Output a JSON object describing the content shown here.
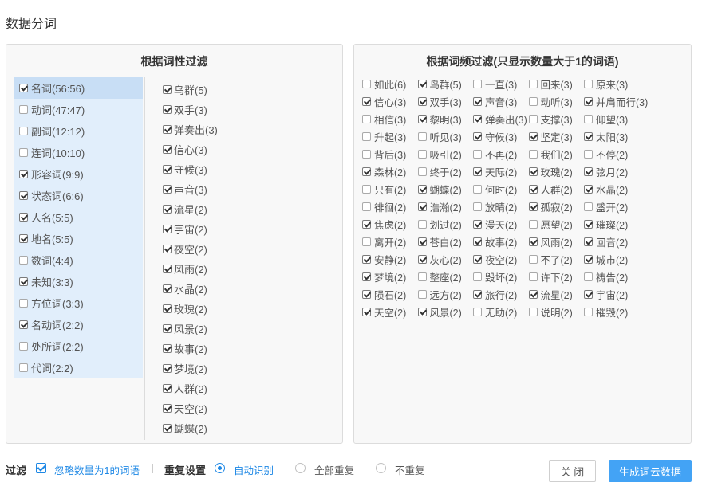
{
  "page": {
    "title": "数据分词"
  },
  "left_panel": {
    "title": "根据词性过滤",
    "pos_items": [
      {
        "label": "名词(56:56)",
        "checked": true,
        "active": true
      },
      {
        "label": "动词(47:47)",
        "checked": false
      },
      {
        "label": "副词(12:12)",
        "checked": false
      },
      {
        "label": "连词(10:10)",
        "checked": false
      },
      {
        "label": "形容词(9:9)",
        "checked": true
      },
      {
        "label": "状态词(6:6)",
        "checked": true
      },
      {
        "label": "人名(5:5)",
        "checked": true
      },
      {
        "label": "地名(5:5)",
        "checked": true
      },
      {
        "label": "数词(4:4)",
        "checked": false
      },
      {
        "label": "未知(3:3)",
        "checked": true
      },
      {
        "label": "方位词(3:3)",
        "checked": false
      },
      {
        "label": "名动词(2:2)",
        "checked": true
      },
      {
        "label": "处所词(2:2)",
        "checked": false
      },
      {
        "label": "代词(2:2)",
        "checked": false
      }
    ],
    "words": [
      {
        "label": "鸟群(5)",
        "checked": true
      },
      {
        "label": "双手(3)",
        "checked": true
      },
      {
        "label": "弹奏出(3)",
        "checked": true
      },
      {
        "label": "信心(3)",
        "checked": true
      },
      {
        "label": "守候(3)",
        "checked": true
      },
      {
        "label": "声音(3)",
        "checked": true
      },
      {
        "label": "流星(2)",
        "checked": true
      },
      {
        "label": "宇宙(2)",
        "checked": true
      },
      {
        "label": "夜空(2)",
        "checked": true
      },
      {
        "label": "风雨(2)",
        "checked": true
      },
      {
        "label": "水晶(2)",
        "checked": true
      },
      {
        "label": "玫瑰(2)",
        "checked": true
      },
      {
        "label": "风景(2)",
        "checked": true
      },
      {
        "label": "故事(2)",
        "checked": true
      },
      {
        "label": "梦境(2)",
        "checked": true
      },
      {
        "label": "人群(2)",
        "checked": true
      },
      {
        "label": "天空(2)",
        "checked": true
      },
      {
        "label": "蝴蝶(2)",
        "checked": true
      }
    ]
  },
  "right_panel": {
    "title": "根据词频过滤(只显示数量大于1的词语)",
    "rows": [
      [
        {
          "label": "如此(6)",
          "checked": false
        },
        {
          "label": "鸟群(5)",
          "checked": true
        },
        {
          "label": "一直(3)",
          "checked": false
        },
        {
          "label": "回来(3)",
          "checked": false
        },
        {
          "label": "原来(3)",
          "checked": false
        }
      ],
      [
        {
          "label": "信心(3)",
          "checked": true
        },
        {
          "label": "双手(3)",
          "checked": true
        },
        {
          "label": "声音(3)",
          "checked": true
        },
        {
          "label": "动听(3)",
          "checked": false
        },
        {
          "label": "并肩而行(3)",
          "checked": true
        }
      ],
      [
        {
          "label": "相信(3)",
          "checked": false
        },
        {
          "label": "黎明(3)",
          "checked": true
        },
        {
          "label": "弹奏出(3)",
          "checked": true
        },
        {
          "label": "支撑(3)",
          "checked": false
        },
        {
          "label": "仰望(3)",
          "checked": false
        }
      ],
      [
        {
          "label": "升起(3)",
          "checked": false
        },
        {
          "label": "听见(3)",
          "checked": false
        },
        {
          "label": "守候(3)",
          "checked": true
        },
        {
          "label": "坚定(3)",
          "checked": true
        },
        {
          "label": "太阳(3)",
          "checked": true
        }
      ],
      [
        {
          "label": "背后(3)",
          "checked": false
        },
        {
          "label": "吸引(2)",
          "checked": false
        },
        {
          "label": "不再(2)",
          "checked": false
        },
        {
          "label": "我们(2)",
          "checked": false
        },
        {
          "label": "不停(2)",
          "checked": false
        }
      ],
      [
        {
          "label": "森林(2)",
          "checked": true
        },
        {
          "label": "终于(2)",
          "checked": false
        },
        {
          "label": "天际(2)",
          "checked": true
        },
        {
          "label": "玫瑰(2)",
          "checked": true
        },
        {
          "label": "弦月(2)",
          "checked": true
        }
      ],
      [
        {
          "label": "只有(2)",
          "checked": false
        },
        {
          "label": "蝴蝶(2)",
          "checked": true
        },
        {
          "label": "何时(2)",
          "checked": false
        },
        {
          "label": "人群(2)",
          "checked": true
        },
        {
          "label": "水晶(2)",
          "checked": true
        }
      ],
      [
        {
          "label": "徘徊(2)",
          "checked": false
        },
        {
          "label": "浩瀚(2)",
          "checked": true
        },
        {
          "label": "放晴(2)",
          "checked": false
        },
        {
          "label": "孤寂(2)",
          "checked": true
        },
        {
          "label": "盛开(2)",
          "checked": false
        }
      ],
      [
        {
          "label": "焦虑(2)",
          "checked": true
        },
        {
          "label": "划过(2)",
          "checked": false
        },
        {
          "label": "漫天(2)",
          "checked": true
        },
        {
          "label": "愿望(2)",
          "checked": false
        },
        {
          "label": "璀璨(2)",
          "checked": true
        }
      ],
      [
        {
          "label": "离开(2)",
          "checked": false
        },
        {
          "label": "苍白(2)",
          "checked": true
        },
        {
          "label": "故事(2)",
          "checked": true
        },
        {
          "label": "风雨(2)",
          "checked": true
        },
        {
          "label": "回音(2)",
          "checked": true
        }
      ],
      [
        {
          "label": "安静(2)",
          "checked": true
        },
        {
          "label": "灰心(2)",
          "checked": true
        },
        {
          "label": "夜空(2)",
          "checked": true
        },
        {
          "label": "不了(2)",
          "checked": false
        },
        {
          "label": "城市(2)",
          "checked": true
        }
      ],
      [
        {
          "label": "梦境(2)",
          "checked": true
        },
        {
          "label": "整座(2)",
          "checked": false
        },
        {
          "label": "毁坏(2)",
          "checked": false
        },
        {
          "label": "许下(2)",
          "checked": false
        },
        {
          "label": "祷告(2)",
          "checked": false
        }
      ],
      [
        {
          "label": "陨石(2)",
          "checked": true
        },
        {
          "label": "远方(2)",
          "checked": false
        },
        {
          "label": "旅行(2)",
          "checked": true
        },
        {
          "label": "流星(2)",
          "checked": true
        },
        {
          "label": "宇宙(2)",
          "checked": true
        }
      ],
      [
        {
          "label": "天空(2)",
          "checked": true
        },
        {
          "label": "风景(2)",
          "checked": true
        },
        {
          "label": "无助(2)",
          "checked": false
        },
        {
          "label": "说明(2)",
          "checked": false
        },
        {
          "label": "摧毁(2)",
          "checked": false
        }
      ]
    ]
  },
  "footer": {
    "filter_label": "过滤",
    "ignore_single_label": "忽略数量为1的词语",
    "ignore_single_checked": true,
    "repeat_label": "重复设置",
    "radio_auto": "自动识别",
    "radio_all": "全部重复",
    "radio_none": "不重复",
    "selected_radio": "auto",
    "close_label": "关 闭",
    "generate_label": "生成词云数据"
  },
  "colors": {
    "accent": "#1e88e5",
    "button_primary": "#43a3f5",
    "pos_list_bg": "#e1eefb",
    "pos_active_bg": "#c8def5"
  }
}
